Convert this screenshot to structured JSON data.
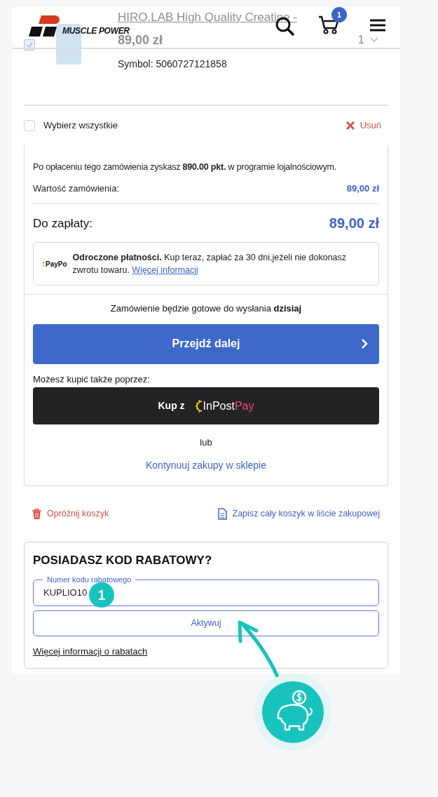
{
  "header": {
    "logo_text": "MUSCLE POWER",
    "cart_count": "1"
  },
  "product": {
    "title": "HIRO.LAB High Quality Creatine -",
    "price": "89,00 zł",
    "quantity": "1",
    "symbol": "Symbol: 5060727121858",
    "checked": true
  },
  "select_all": {
    "label": "Wybierz wszystkie",
    "checked": false
  },
  "remove_label": "Usuń",
  "summary": {
    "loyalty": "Po opłaceniu tego zamówienia zyskasz **890.00 pkt.** w programie lojalnościowym.",
    "order_value_label": "Wartość zamówienia:",
    "order_value": "89,00 zł",
    "total_label": "Do zapłaty:",
    "total": "89,00 zł",
    "paypo": {
      "logo": "PayPo",
      "text": "**Odroczone płatności.** Kup teraz, zapłać za 30 dni,jeżeli nie dokonasz zwrotu towaru.",
      "link": "Więcej informacji"
    },
    "ready": "Zamówienie będzie gotowe do wysłania **dzisiaj**",
    "proceed": "Przejdź dalej",
    "alt_label": "Możesz kupić także poprzez:",
    "inpost": {
      "prefix": "Kup z",
      "brand": "InPost",
      "accent": "Pay"
    },
    "or": "lub",
    "continue": "Kontynuuj zakupy w sklepie"
  },
  "cart_actions": [
    {
      "kind": "empty",
      "label": "Opróżnij koszyk"
    },
    {
      "kind": "save",
      "label": "Zapisz cały koszyk w liście zakupowej"
    }
  ],
  "coupon": {
    "title": "POSIADASZ KOD RABATOWY?",
    "field_label": "Numer kodu rabatowego",
    "value": "KUPLIO10",
    "button": "Aktywuj",
    "more": "Więcej informacji o rabatach"
  },
  "tutorial": {
    "step": "1"
  }
}
